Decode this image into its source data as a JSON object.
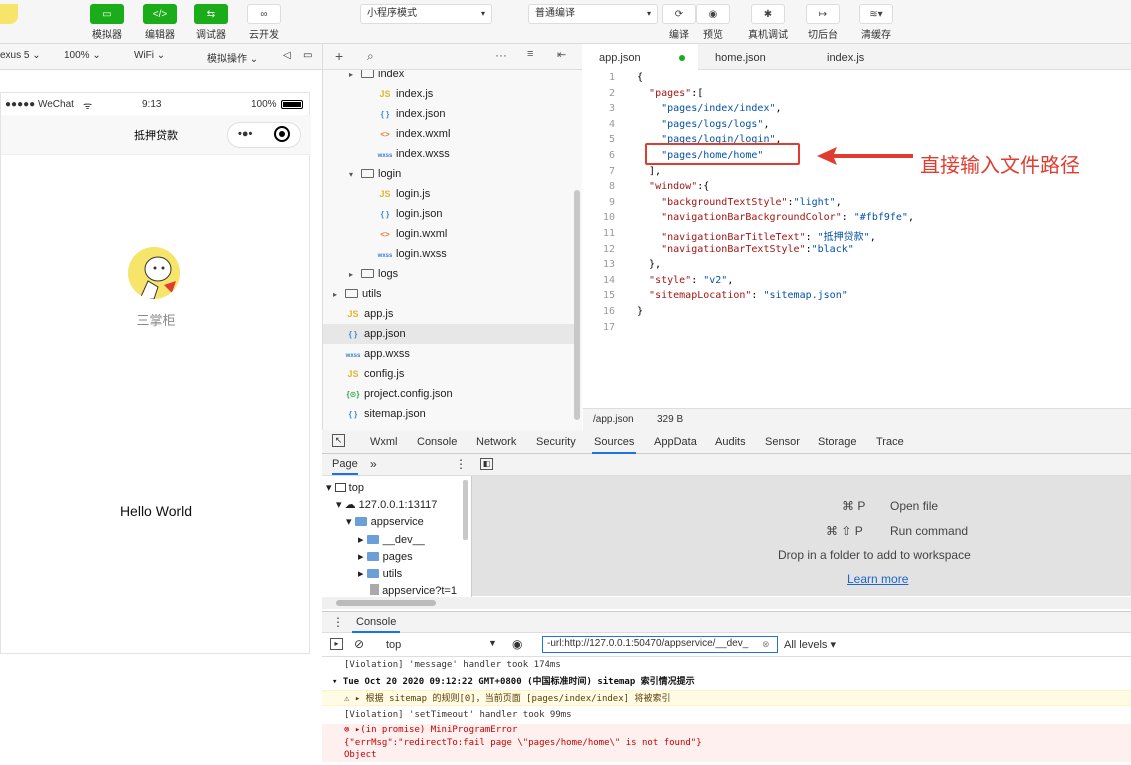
{
  "toolbar": {
    "tools": [
      {
        "label": "模拟器",
        "glyph": "▭"
      },
      {
        "label": "编辑器",
        "glyph": "</>"
      },
      {
        "label": "调试器",
        "glyph": "⇆"
      },
      {
        "label": "云开发",
        "glyph": "∞"
      }
    ],
    "mode_select": "小程序模式",
    "compile_select": "普通编译",
    "actions": [
      "编译",
      "预览",
      "真机调试",
      "切后台",
      "清缓存"
    ]
  },
  "simulator": {
    "device": "exus 5",
    "zoom": "100%",
    "network": "WiFi",
    "operation": "模拟操作",
    "status_carrier": "●●●●● WeChat",
    "status_time": "9:13",
    "status_battery": "100%",
    "nav_title": "抵押贷款",
    "avatar_name": "三掌柜",
    "body_text": "Hello World"
  },
  "file_tree": {
    "items": [
      {
        "name": "index",
        "type": "folder",
        "depth": 1
      },
      {
        "name": "index.js",
        "type": "js",
        "depth": 2
      },
      {
        "name": "index.json",
        "type": "json",
        "depth": 2
      },
      {
        "name": "index.wxml",
        "type": "wxml",
        "depth": 2
      },
      {
        "name": "index.wxss",
        "type": "wxss",
        "depth": 2
      },
      {
        "name": "login",
        "type": "folder-open",
        "depth": 1
      },
      {
        "name": "login.js",
        "type": "js",
        "depth": 2
      },
      {
        "name": "login.json",
        "type": "json",
        "depth": 2
      },
      {
        "name": "login.wxml",
        "type": "wxml",
        "depth": 2
      },
      {
        "name": "login.wxss",
        "type": "wxss",
        "depth": 2
      },
      {
        "name": "logs",
        "type": "folder",
        "depth": 1
      },
      {
        "name": "utils",
        "type": "folder",
        "depth": 0
      },
      {
        "name": "app.js",
        "type": "js",
        "depth": 0
      },
      {
        "name": "app.json",
        "type": "json",
        "depth": 0,
        "selected": true
      },
      {
        "name": "app.wxss",
        "type": "wxss",
        "depth": 0
      },
      {
        "name": "config.js",
        "type": "js",
        "depth": 0
      },
      {
        "name": "project.config.json",
        "type": "cfg",
        "depth": 0
      },
      {
        "name": "sitemap.json",
        "type": "json",
        "depth": 0
      }
    ]
  },
  "editor": {
    "tabs": [
      "app.json",
      "home.json",
      "index.js"
    ],
    "lines": [
      "{",
      "  \"pages\":[",
      "    \"pages/index/index\",",
      "    \"pages/logs/logs\",",
      "    \"pages/login/login\",",
      "    \"pages/home/home\"",
      "  ],",
      "  \"window\":{",
      "    \"backgroundTextStyle\":\"light\",",
      "    \"navigationBarBackgroundColor\": \"#fbf9fe\",",
      "    \"navigationBarTitleText\": \"抵押贷款\",",
      "    \"navigationBarTextStyle\":\"black\"",
      "  },",
      "  \"style\": \"v2\",",
      "  \"sitemapLocation\": \"sitemap.json\"",
      "}",
      ""
    ],
    "annotation": "直接输入文件路径",
    "status_file": "/app.json",
    "status_size": "329 B"
  },
  "devtools": {
    "tabs": [
      "Wxml",
      "Console",
      "Network",
      "Security",
      "Sources",
      "AppData",
      "Audits",
      "Sensor",
      "Storage",
      "Trace"
    ],
    "active_tab": "Sources",
    "page_tab": "Page",
    "more": "»",
    "sources_tree": [
      "top",
      "127.0.0.1:13117",
      "appservice",
      "__dev__",
      "pages",
      "utils",
      "appservice?t=1"
    ],
    "shortcuts": [
      {
        "key": "⌘ P",
        "label": "Open file"
      },
      {
        "key": "⌘ ⇧ P",
        "label": "Run command"
      }
    ],
    "drop_text": "Drop in a folder to add to workspace",
    "learn_more": "Learn more",
    "console_title": "Console",
    "context": "top",
    "filter_value": "-url:http://127.0.0.1:50470/appservice/__dev_",
    "levels": "All levels ▾",
    "messages": [
      {
        "kind": "info",
        "text": "[Violation] 'message' handler took 174ms"
      },
      {
        "kind": "bold",
        "text": "▾ Tue Oct 20 2020 09:12:22 GMT+0800 (中国标准时间) sitemap 索引情况提示"
      },
      {
        "kind": "warn",
        "text": "⚠ ▸ 根据 sitemap 的规则[0]，当前页面 [pages/index/index] 将被索引"
      },
      {
        "kind": "info",
        "text": "[Violation] 'setTimeout' handler took 99ms"
      },
      {
        "kind": "err",
        "text": "⊗ ▸(in promise) MiniProgramError"
      },
      {
        "kind": "err",
        "text": "{\"errMsg\":\"redirectTo:fail page \\\"pages/home/home\\\" is not found\"}"
      },
      {
        "kind": "err",
        "text": "Object"
      }
    ]
  },
  "colors": {
    "accent_green": "#1aad19",
    "annotation_red": "#e03c2f",
    "link_blue": "#1a66cc"
  }
}
